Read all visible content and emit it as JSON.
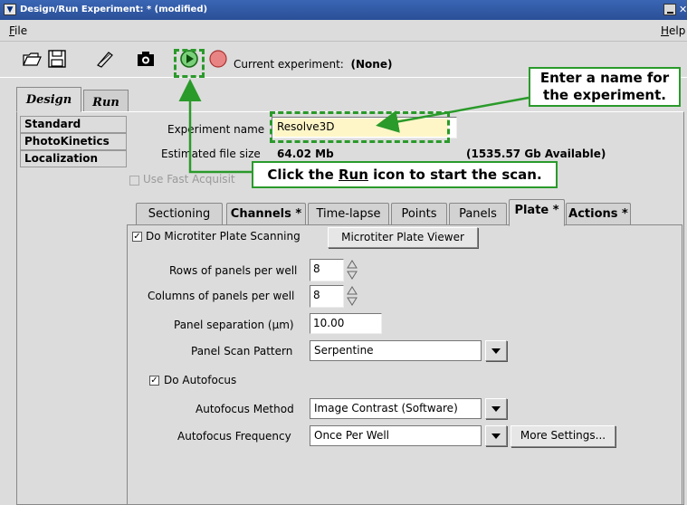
{
  "window": {
    "title": "Design/Run Experiment: * (modified)"
  },
  "menu": {
    "file": "File",
    "help": "Help"
  },
  "toolbar": {
    "current_label": "Current experiment:",
    "current_value": "(None)"
  },
  "outer_tabs": [
    "Design",
    "Run"
  ],
  "left_list": [
    "Standard",
    "PhotoKinetics",
    "Localization"
  ],
  "experiment": {
    "name_label": "Experiment name",
    "name_value": "Resolve3D",
    "size_label": "Estimated file size",
    "size_value": "64.02 Mb",
    "available": "(1535.57 Gb Available)",
    "fast_acq": "Use Fast Acquisit"
  },
  "inner_tabs": [
    "Sectioning",
    "Channels *",
    "Time-lapse",
    "Points",
    "Panels",
    "Plate *",
    "Actions *"
  ],
  "plate": {
    "do_scanning": "Do Microtiter Plate Scanning",
    "viewer_button": "Microtiter Plate Viewer",
    "rows_label": "Rows of panels per well",
    "rows_value": "8",
    "cols_label": "Columns of panels per well",
    "cols_value": "8",
    "sep_label": "Panel separation (µm)",
    "sep_value": "10.00",
    "pattern_label": "Panel Scan Pattern",
    "pattern_value": "Serpentine",
    "do_autofocus": "Do Autofocus",
    "af_method_label": "Autofocus Method",
    "af_method_value": "Image Contrast (Software)",
    "af_freq_label": "Autofocus Frequency",
    "af_freq_value": "Once Per Well",
    "more_settings": "More Settings..."
  },
  "callouts": {
    "name_line1": "Enter a name for",
    "name_line2": "the experiment.",
    "run_pre": "Click the ",
    "run_word": "Run",
    "run_post": " icon to start the scan."
  },
  "colors": {
    "titlebar": "#2a4f97",
    "callout_green": "#2a9a2a",
    "field_highlight": "#fff6c8",
    "panel_bg": "#dcdcdc"
  }
}
